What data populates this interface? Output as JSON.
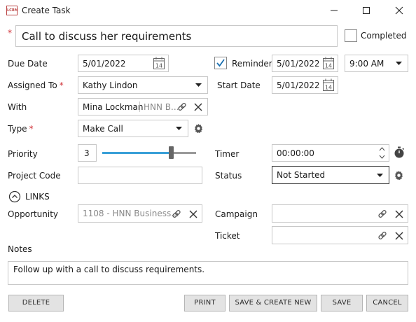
{
  "window": {
    "title": "Create Task",
    "app_icon_text": "LCRM"
  },
  "task": {
    "subject": "Call to discuss her requirements",
    "completed_label": "Completed"
  },
  "labels": {
    "due_date": "Due Date",
    "reminder": "Reminder",
    "assigned_to": "Assigned To",
    "start_date": "Start Date",
    "with": "With",
    "type": "Type",
    "priority": "Priority",
    "timer": "Timer",
    "project_code": "Project Code",
    "status": "Status",
    "links": "LINKS",
    "opportunity": "Opportunity",
    "campaign": "Campaign",
    "ticket": "Ticket",
    "notes": "Notes"
  },
  "values": {
    "due_date": "5/01/2022",
    "reminder_checked": true,
    "reminder_date": "5/01/2022",
    "reminder_time": "9:00 AM",
    "assigned_to": "Kathy Lindon",
    "start_date": "5/01/2022",
    "with_name": "Mina Lockman",
    "with_company": "HNN B...",
    "type": "Make Call",
    "priority": "3",
    "priority_level": 0.75,
    "timer": "00:00:00",
    "project_code": "",
    "status": "Not Started",
    "opportunity": "1108 - HNN Business...",
    "campaign": "",
    "ticket": "",
    "notes": "Follow up with a call to discuss requirements.",
    "calendar_day": "14"
  },
  "buttons": {
    "delete": "DELETE",
    "print": "PRINT",
    "save_create_new": "SAVE & CREATE NEW",
    "save": "SAVE",
    "cancel": "CANCEL"
  },
  "colors": {
    "accent": "#3aa0d8",
    "required": "#d1343a",
    "button_bg": "#e3e3e3"
  }
}
